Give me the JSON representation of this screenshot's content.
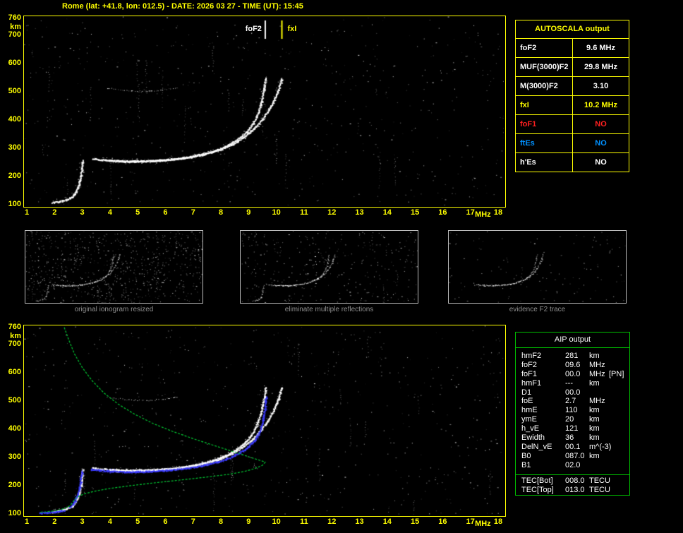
{
  "title": "Rome (lat: +41.8, lon: 012.5) - DATE: 2026 03 27 - TIME (UT): 15:45",
  "colors": {
    "accent_yellow": "#ffff00",
    "trace_white": "#ffffff",
    "profile_green": "#00cc33",
    "restored_blue": "#3c3cff",
    "no_red": "#ff2020",
    "es_blue": "#0090ff",
    "caption_gray": "#8f8f8f",
    "aip_border_green": "#00c000"
  },
  "autoscala_table": {
    "title": "AUTOSCALA output",
    "rows": [
      {
        "label": "foF2",
        "value": "9.6 MHz",
        "color": "#ffffff"
      },
      {
        "label": "MUF(3000)F2",
        "value": "29.8 MHz",
        "color": "#ffffff"
      },
      {
        "label": "M(3000)F2",
        "value": "3.10",
        "color": "#ffffff"
      },
      {
        "label": "fxI",
        "value": "10.2 MHz",
        "color": "#ffff00"
      },
      {
        "label": "foF1",
        "value": "NO",
        "color": "#ff2020"
      },
      {
        "label": "ftEs",
        "value": "NO",
        "color": "#0090ff"
      },
      {
        "label": "h'Es",
        "value": "NO",
        "color": "#ffffff"
      }
    ]
  },
  "aip_table": {
    "title": "AIP output",
    "rows": [
      {
        "label": "hmF2",
        "value": "281",
        "unit": "km"
      },
      {
        "label": "foF2",
        "value": "09.6",
        "unit": "MHz"
      },
      {
        "label": "foF1",
        "value": "00.0",
        "unit": "MHz",
        "extra": "[PN]"
      },
      {
        "label": "hmF1",
        "value": "---",
        "unit": "km"
      },
      {
        "label": "D1",
        "value": "00.0",
        "unit": ""
      },
      {
        "label": "foE",
        "value": "2.7",
        "unit": "MHz"
      },
      {
        "label": "hmE",
        "value": "110",
        "unit": "km"
      },
      {
        "label": "ymE",
        "value": "20",
        "unit": "km"
      },
      {
        "label": "h_vE",
        "value": "121",
        "unit": "km"
      },
      {
        "label": "Ewidth",
        "value": "36",
        "unit": "km"
      },
      {
        "label": "DelN_vE",
        "value": "00.1",
        "unit": "m^(-3)"
      },
      {
        "label": "B0",
        "value": "087.0",
        "unit": "km"
      },
      {
        "label": "B1",
        "value": "02.0",
        "unit": ""
      }
    ],
    "tec_rows": [
      {
        "label": "TEC[Bot]",
        "value": "008.0",
        "unit": "TECU"
      },
      {
        "label": "TEC[Top]",
        "value": "013.0",
        "unit": "TECU"
      }
    ]
  },
  "thumbnails": [
    {
      "caption": "original ionogram resized"
    },
    {
      "caption": "eliminate multiple reflections"
    },
    {
      "caption": "evidence F2 trace"
    }
  ],
  "chart_data": [
    {
      "id": "ionogram-top",
      "type": "scatter",
      "title": "recorded ionogram with autoscaled characteristics",
      "xlabel": "MHz",
      "ylabel": "km",
      "xlim": [
        1,
        18
      ],
      "ylim": [
        100,
        760
      ],
      "x_ticks": [
        1,
        2,
        3,
        4,
        5,
        6,
        7,
        8,
        9,
        10,
        11,
        12,
        13,
        14,
        15,
        16,
        17,
        18
      ],
      "y_ticks": [
        760,
        700,
        600,
        500,
        400,
        300,
        200,
        100
      ],
      "markers": [
        {
          "label": "foF2",
          "mhz": 9.6,
          "color": "#ffffff",
          "side": "left"
        },
        {
          "label": "fxI",
          "mhz": 10.2,
          "color": "#ffff00",
          "side": "right"
        }
      ],
      "series": [
        {
          "name": "E-region echo cusp",
          "color": "#ffffff",
          "points": [
            [
              1.9,
              106
            ],
            [
              2.15,
              110
            ],
            [
              2.4,
              116
            ],
            [
              2.62,
              126
            ],
            [
              2.76,
              143
            ],
            [
              2.86,
              168
            ],
            [
              2.93,
              198
            ],
            [
              2.97,
              230
            ],
            [
              3.0,
              256
            ]
          ]
        },
        {
          "name": "F2 ordinary trace",
          "color": "#ffffff",
          "points": [
            [
              3.35,
              262
            ],
            [
              3.8,
              257
            ],
            [
              4.3,
              254
            ],
            [
              4.9,
              253
            ],
            [
              5.5,
              255
            ],
            [
              6.1,
              259
            ],
            [
              6.7,
              266
            ],
            [
              7.2,
              275
            ],
            [
              7.7,
              288
            ],
            [
              8.15,
              305
            ],
            [
              8.55,
              327
            ],
            [
              8.9,
              355
            ],
            [
              9.15,
              388
            ],
            [
              9.33,
              425
            ],
            [
              9.45,
              465
            ],
            [
              9.54,
              510
            ],
            [
              9.6,
              548
            ]
          ]
        },
        {
          "name": "F2 extraordinary trace",
          "color": "#ffffff",
          "points": [
            [
              3.95,
              256
            ],
            [
              4.5,
              252
            ],
            [
              5.1,
              252
            ],
            [
              5.7,
              255
            ],
            [
              6.3,
              260
            ],
            [
              6.9,
              268
            ],
            [
              7.45,
              279
            ],
            [
              7.95,
              294
            ],
            [
              8.4,
              313
            ],
            [
              8.8,
              337
            ],
            [
              9.15,
              365
            ],
            [
              9.45,
              398
            ],
            [
              9.7,
              432
            ],
            [
              9.9,
              468
            ],
            [
              10.05,
              505
            ],
            [
              10.18,
              548
            ]
          ]
        },
        {
          "name": "second-hop multiple",
          "color": "#ffffff",
          "faint": true,
          "points": [
            [
              3.9,
              512
            ],
            [
              4.6,
              503
            ],
            [
              5.3,
              500
            ],
            [
              5.9,
              505
            ],
            [
              6.4,
              512
            ]
          ]
        }
      ],
      "noise": {
        "count": 640,
        "streaks": 24,
        "seed": 11
      }
    },
    {
      "id": "ionogram-bottom",
      "type": "scatter",
      "title": "ionogram with restored trace and electron density profile",
      "xlabel": "MHz",
      "ylabel": "km",
      "xlim": [
        1,
        18
      ],
      "ylim": [
        100,
        760
      ],
      "x_ticks": [
        1,
        2,
        3,
        4,
        5,
        6,
        7,
        8,
        9,
        10,
        11,
        12,
        13,
        14,
        15,
        16,
        17,
        18
      ],
      "y_ticks": [
        760,
        700,
        600,
        500,
        400,
        300,
        200,
        100
      ],
      "markers": [],
      "series": [
        {
          "name": "E-region echo cusp",
          "color": "#ffffff",
          "points": [
            [
              1.9,
              106
            ],
            [
              2.15,
              110
            ],
            [
              2.4,
              116
            ],
            [
              2.62,
              126
            ],
            [
              2.76,
              143
            ],
            [
              2.86,
              168
            ],
            [
              2.93,
              198
            ],
            [
              2.97,
              230
            ],
            [
              3.0,
              256
            ]
          ]
        },
        {
          "name": "F2 ordinary trace",
          "color": "#ffffff",
          "points": [
            [
              3.35,
              262
            ],
            [
              3.8,
              257
            ],
            [
              4.3,
              254
            ],
            [
              4.9,
              253
            ],
            [
              5.5,
              255
            ],
            [
              6.1,
              259
            ],
            [
              6.7,
              266
            ],
            [
              7.2,
              275
            ],
            [
              7.7,
              288
            ],
            [
              8.15,
              305
            ],
            [
              8.55,
              327
            ],
            [
              8.9,
              355
            ],
            [
              9.15,
              388
            ],
            [
              9.33,
              425
            ],
            [
              9.45,
              465
            ],
            [
              9.54,
              510
            ],
            [
              9.6,
              548
            ]
          ]
        },
        {
          "name": "F2 extraordinary trace",
          "color": "#ffffff",
          "points": [
            [
              3.95,
              256
            ],
            [
              4.5,
              252
            ],
            [
              5.1,
              252
            ],
            [
              5.7,
              255
            ],
            [
              6.3,
              260
            ],
            [
              6.9,
              268
            ],
            [
              7.45,
              279
            ],
            [
              7.95,
              294
            ],
            [
              8.4,
              313
            ],
            [
              8.8,
              337
            ],
            [
              9.15,
              365
            ],
            [
              9.45,
              398
            ],
            [
              9.7,
              432
            ],
            [
              9.9,
              468
            ],
            [
              10.05,
              505
            ],
            [
              10.18,
              548
            ]
          ]
        },
        {
          "name": "second-hop multiple",
          "color": "#ffffff",
          "faint": true,
          "points": [
            [
              3.9,
              512
            ],
            [
              4.6,
              503
            ],
            [
              5.3,
              500
            ],
            [
              5.9,
              505
            ],
            [
              6.4,
              512
            ]
          ]
        },
        {
          "name": "restored trace low",
          "color": "#3c3cff",
          "points": [
            [
              1.45,
              102
            ],
            [
              1.75,
              104
            ],
            [
              2.05,
              107
            ],
            [
              2.35,
              112
            ]
          ]
        },
        {
          "name": "restored trace E",
          "color": "#3c3cff",
          "points": [
            [
              2.55,
              124
            ],
            [
              2.7,
              140
            ],
            [
              2.8,
              163
            ],
            [
              2.88,
              192
            ],
            [
              2.93,
              224
            ],
            [
              2.97,
              250
            ]
          ]
        },
        {
          "name": "restored trace F2",
          "color": "#3c3cff",
          "points": [
            [
              3.3,
              256
            ],
            [
              3.9,
              251
            ],
            [
              4.6,
              248
            ],
            [
              5.3,
              249
            ],
            [
              6.0,
              253
            ],
            [
              6.7,
              260
            ],
            [
              7.3,
              270
            ],
            [
              7.9,
              284
            ],
            [
              8.4,
              302
            ],
            [
              8.85,
              327
            ],
            [
              9.2,
              358
            ],
            [
              9.4,
              392
            ],
            [
              9.5,
              430
            ],
            [
              9.57,
              472
            ],
            [
              9.62,
              515
            ]
          ]
        },
        {
          "name": "electron density profile",
          "color": "#00cc33",
          "style": "line",
          "points": [
            [
              2.35,
              758
            ],
            [
              2.52,
              712
            ],
            [
              2.72,
              664
            ],
            [
              3.0,
              616
            ],
            [
              3.35,
              570
            ],
            [
              3.78,
              526
            ],
            [
              4.3,
              486
            ],
            [
              4.9,
              450
            ],
            [
              5.55,
              418
            ],
            [
              6.25,
              390
            ],
            [
              7.0,
              364
            ],
            [
              7.75,
              340
            ],
            [
              8.45,
              318
            ],
            [
              9.0,
              300
            ],
            [
              9.38,
              288
            ],
            [
              9.58,
              282
            ],
            [
              9.6,
              281
            ],
            [
              9.5,
              270
            ],
            [
              9.25,
              259
            ],
            [
              8.85,
              248
            ],
            [
              8.3,
              238
            ],
            [
              7.65,
              230
            ],
            [
              6.95,
              222
            ],
            [
              6.2,
              214
            ],
            [
              5.45,
              206
            ],
            [
              4.7,
              197
            ],
            [
              4.0,
              188
            ],
            [
              3.45,
              178
            ],
            [
              3.05,
              168
            ],
            [
              2.82,
              157
            ],
            [
              2.7,
              146
            ],
            [
              2.64,
              136
            ],
            [
              2.56,
              127
            ],
            [
              2.42,
              119
            ],
            [
              2.22,
              113
            ],
            [
              1.98,
              108
            ],
            [
              1.7,
              105
            ],
            [
              1.45,
              103
            ]
          ]
        }
      ],
      "noise": {
        "count": 640,
        "streaks": 20,
        "seed": 29
      }
    },
    {
      "id": "thumb-original",
      "type": "scatter",
      "source_index": 0,
      "include_series": [
        0,
        1,
        2,
        3
      ],
      "noise": {
        "count": 700,
        "streaks": 30,
        "seed": 5
      }
    },
    {
      "id": "thumb-cleaned",
      "type": "scatter",
      "source_index": 0,
      "include_series": [
        0,
        1,
        2
      ],
      "noise": {
        "count": 320,
        "streaks": 12,
        "seed": 6
      }
    },
    {
      "id": "thumb-f2-evidence",
      "type": "scatter",
      "source_index": 0,
      "include_series": [
        1,
        2
      ],
      "noise": {
        "count": 120,
        "streaks": 4,
        "seed": 7
      }
    }
  ]
}
